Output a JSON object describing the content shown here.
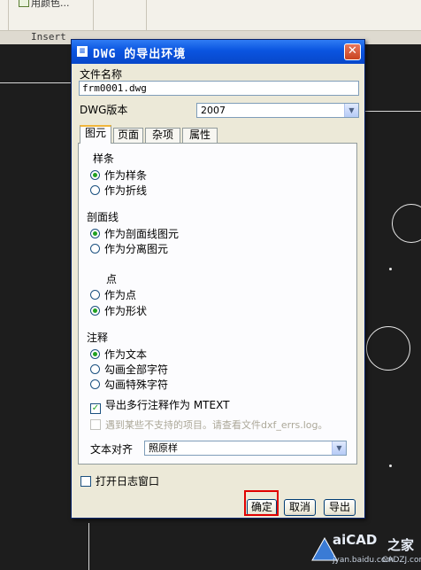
{
  "background": {
    "ribbon_snippet": "用颜色...",
    "ribbon_group_label": "Insert"
  },
  "dialog": {
    "title": "DWG 的导出环境",
    "close_icon": "close-icon",
    "filename_label": "文件名称",
    "filename_value": "frm0001.dwg",
    "version_label": "DWG版本",
    "version_value": "2007",
    "tabs": [
      "图元",
      "页面",
      "杂项",
      "属性"
    ],
    "active_tab": "图元",
    "spline": {
      "title": "样条",
      "options": [
        "作为样条",
        "作为折线"
      ],
      "selected": "作为样条"
    },
    "hatch": {
      "title": "剖面线",
      "options": [
        "作为剖面线图元",
        "作为分离图元"
      ],
      "selected": "作为剖面线图元"
    },
    "point": {
      "title": "点",
      "options": [
        "作为点",
        "作为形状"
      ],
      "selected": "作为形状"
    },
    "annotation": {
      "title": "注释",
      "options": [
        "作为文本",
        "勾画全部字符",
        "勾画特殊字符"
      ],
      "selected": "作为文本"
    },
    "mtext_checkbox": {
      "label": "导出多行注释作为 MTEXT",
      "checked": true
    },
    "unsupported_checkbox": {
      "label": "遇到某些不支持的项目。请查看文件dxf_errs.log。",
      "checked": false,
      "disabled": true
    },
    "text_align": {
      "label": "文本对齐",
      "value": "照原样"
    },
    "log_checkbox": {
      "label": "打开日志窗口",
      "checked": false
    },
    "buttons": {
      "ok": "确定",
      "cancel": "取消",
      "export": "导出"
    }
  },
  "watermark": {
    "brand": "aiCAD",
    "suffix": "之家",
    "url": "jyan.baidu.com",
    "url2": "CADZJ.com"
  },
  "colors": {
    "titlebar": "#0a54e0",
    "dialog_bg": "#ece9d8",
    "highlight": "#e00000",
    "radio_dot": "#21a121",
    "canvas": "#1d1d1d"
  }
}
